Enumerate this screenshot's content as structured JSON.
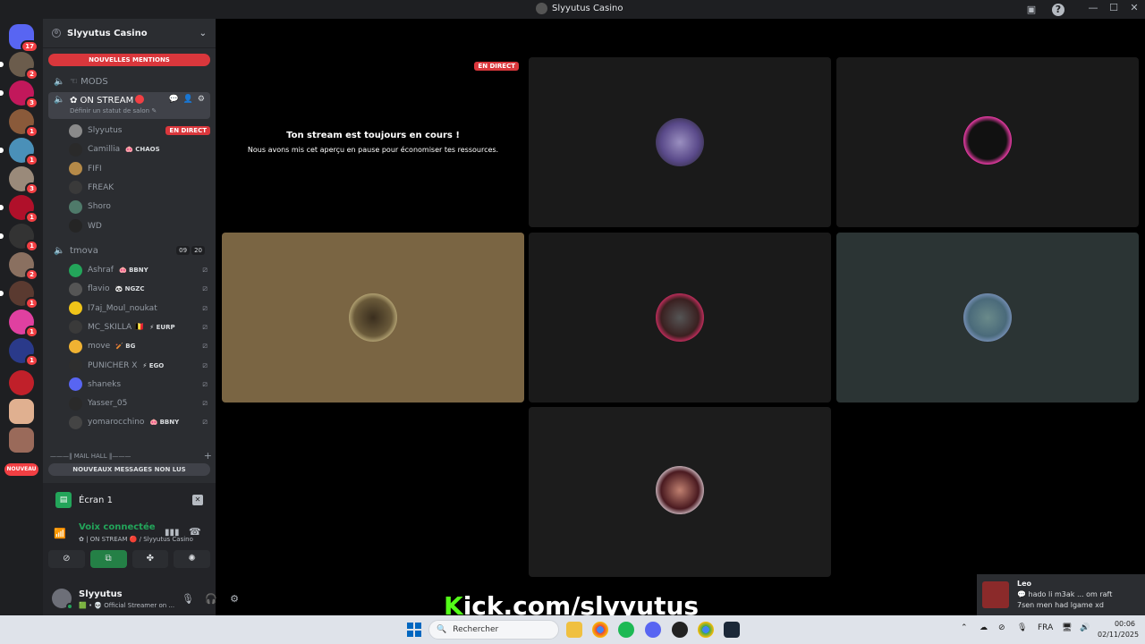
{
  "window": {
    "title": "Slyyutus Casino",
    "controls": [
      "—",
      "☐",
      "✕"
    ]
  },
  "guilds": {
    "home_badge": "17",
    "badges": [
      "2",
      "3",
      "1",
      "1",
      "3",
      "1",
      "1",
      "2",
      "1",
      "1",
      "1"
    ],
    "new_label": "NOUVEAU"
  },
  "server": {
    "name": "Slyyutus Casino",
    "boost_count": "0",
    "mentions_label": "NOUVELLES MENTIONS"
  },
  "channels": {
    "mods": "☜ MODS",
    "onstream": "✿ ON STREAM",
    "onstream_status": "Définir un statut de salon ✎",
    "tmova": "tmova",
    "tmova_counts": [
      "09",
      "20"
    ],
    "category": "———‖ MAIL HALL ‖———",
    "unread_label": "NOUVEAUX MESSAGES NON LUS"
  },
  "onstream_users": [
    {
      "name": "Slyyutus",
      "tag": "",
      "live": "EN DIRECT",
      "color": "#8a8a8a"
    },
    {
      "name": "Camillia",
      "tag": "🐽 CHAOS",
      "live": "",
      "color": "#2a2a2a"
    },
    {
      "name": "FIFI",
      "tag": "",
      "live": "",
      "color": "#b58a48"
    },
    {
      "name": "FREAK",
      "tag": "",
      "live": "",
      "color": "#3a3a3a"
    },
    {
      "name": "Shoro",
      "tag": "",
      "live": "",
      "color": "#4f7a6a"
    },
    {
      "name": "WD",
      "tag": "",
      "live": "",
      "color": "#252525"
    }
  ],
  "tmova_users": [
    {
      "name": "Ashraf",
      "tag": "🐽 BBNY",
      "color": "#23a55a"
    },
    {
      "name": "flavio",
      "tag": "🐼 NGZC",
      "color": "#555555"
    },
    {
      "name": "l7aj_Moul_noukat",
      "tag": "",
      "color": "#f0c419"
    },
    {
      "name": "MC_SKILLA 🇧🇪",
      "tag": "⚡ EURP",
      "color": "#3a3a3a"
    },
    {
      "name": "move",
      "tag": "🏏 BG",
      "color": "#f0b232"
    },
    {
      "name": "PUNICHER X",
      "tag": "⚡ EGO",
      "color": "#2e2e2e"
    },
    {
      "name": "shaneks",
      "tag": "",
      "color": "#5865f2"
    },
    {
      "name": "Yasser_05",
      "tag": "",
      "color": "#2a2a2a"
    },
    {
      "name": "yomarocchino",
      "tag": "🐽 BBNY",
      "color": "#444444"
    }
  ],
  "panel": {
    "screen_label": "Écran 1",
    "voice_title": "Voix connectée",
    "voice_sub": "✿ | ON STREAM 🔴 / Slyyutus Casino",
    "user_name": "Slyyutus",
    "user_status": "🟩 • 💀 Official Streamer on ..."
  },
  "stage": {
    "live_label": "EN DIRECT",
    "paused_title": "Ton stream est toujours en cours !",
    "paused_sub": "Nous avons mis cet aperçu en pause pour économiser tes ressources."
  },
  "overlay": {
    "kick_k": "K",
    "kick_rest": "ick.com/slyyutus"
  },
  "toast": {
    "name": "Leo",
    "line1": "💬 hado li m3ak ... om raft",
    "line2": "7sen men had lgame xd"
  },
  "taskbar": {
    "search_placeholder": "Rechercher",
    "lang": "FRA",
    "time": "00:06",
    "date": "02/11/2025"
  },
  "colors": {
    "accent_red": "#da373c",
    "online_green": "#23a55a",
    "kick_green": "#53fc18",
    "tile_gold": "#7a6543",
    "tile_slate": "#2b3434"
  }
}
